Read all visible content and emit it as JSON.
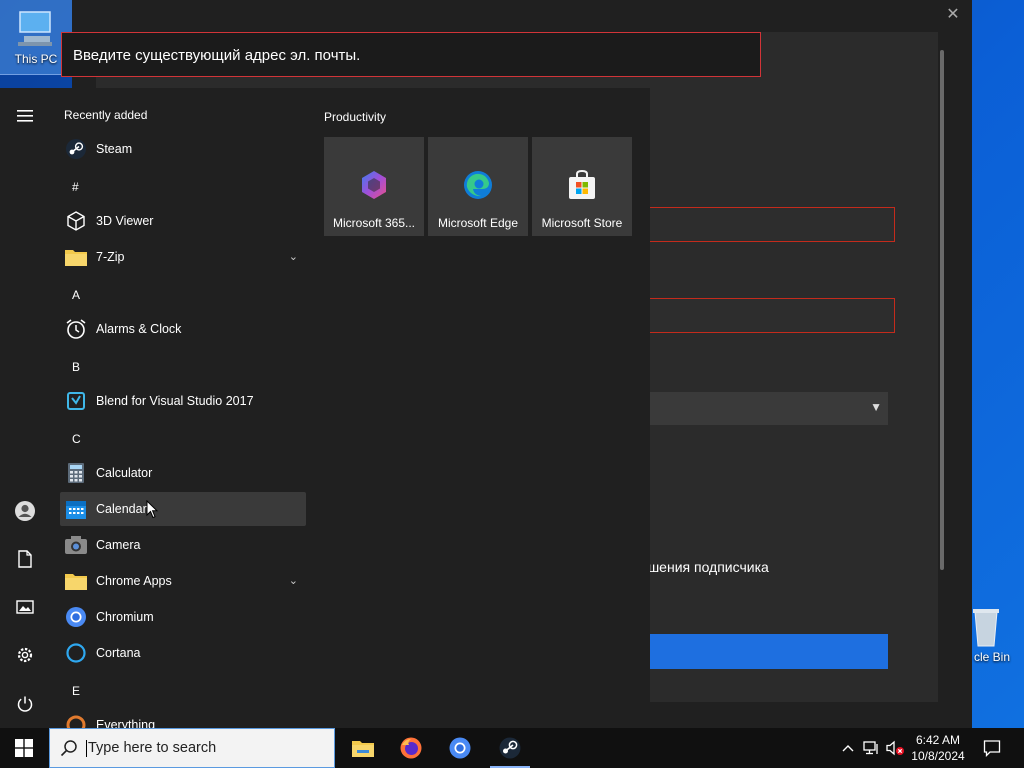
{
  "desktop": {
    "icons": [
      {
        "label": "This PC"
      },
      {
        "label": "cle Bin"
      }
    ]
  },
  "background_window": {
    "error_message": "Введите существующий адрес эл. почты.",
    "partial_text": "лашения подписчика"
  },
  "start_menu": {
    "recently_added_header": "Recently added",
    "apps": {
      "steam": "Steam",
      "hash": "#",
      "viewer3d": "3D Viewer",
      "zip7": "7-Zip",
      "letter_a": "A",
      "alarms": "Alarms & Clock",
      "letter_b": "B",
      "blend": "Blend for Visual Studio 2017",
      "letter_c": "C",
      "calculator": "Calculator",
      "calendar": "Calendar",
      "camera": "Camera",
      "chrome_apps": "Chrome Apps",
      "chromium": "Chromium",
      "cortana": "Cortana",
      "letter_e": "E",
      "everything": "Everything"
    },
    "tiles_header": "Productivity",
    "tiles": [
      {
        "label": "Microsoft 365..."
      },
      {
        "label": "Microsoft Edge"
      },
      {
        "label": "Microsoft Store"
      }
    ]
  },
  "taskbar": {
    "search_placeholder": "Type here to search",
    "time": "6:42 AM",
    "date": "10/8/2024"
  },
  "colors": {
    "accent": "#1e6fe0",
    "error_border": "#d13438",
    "menu_bg": "#202020",
    "tile_bg": "#3a3a3a"
  }
}
